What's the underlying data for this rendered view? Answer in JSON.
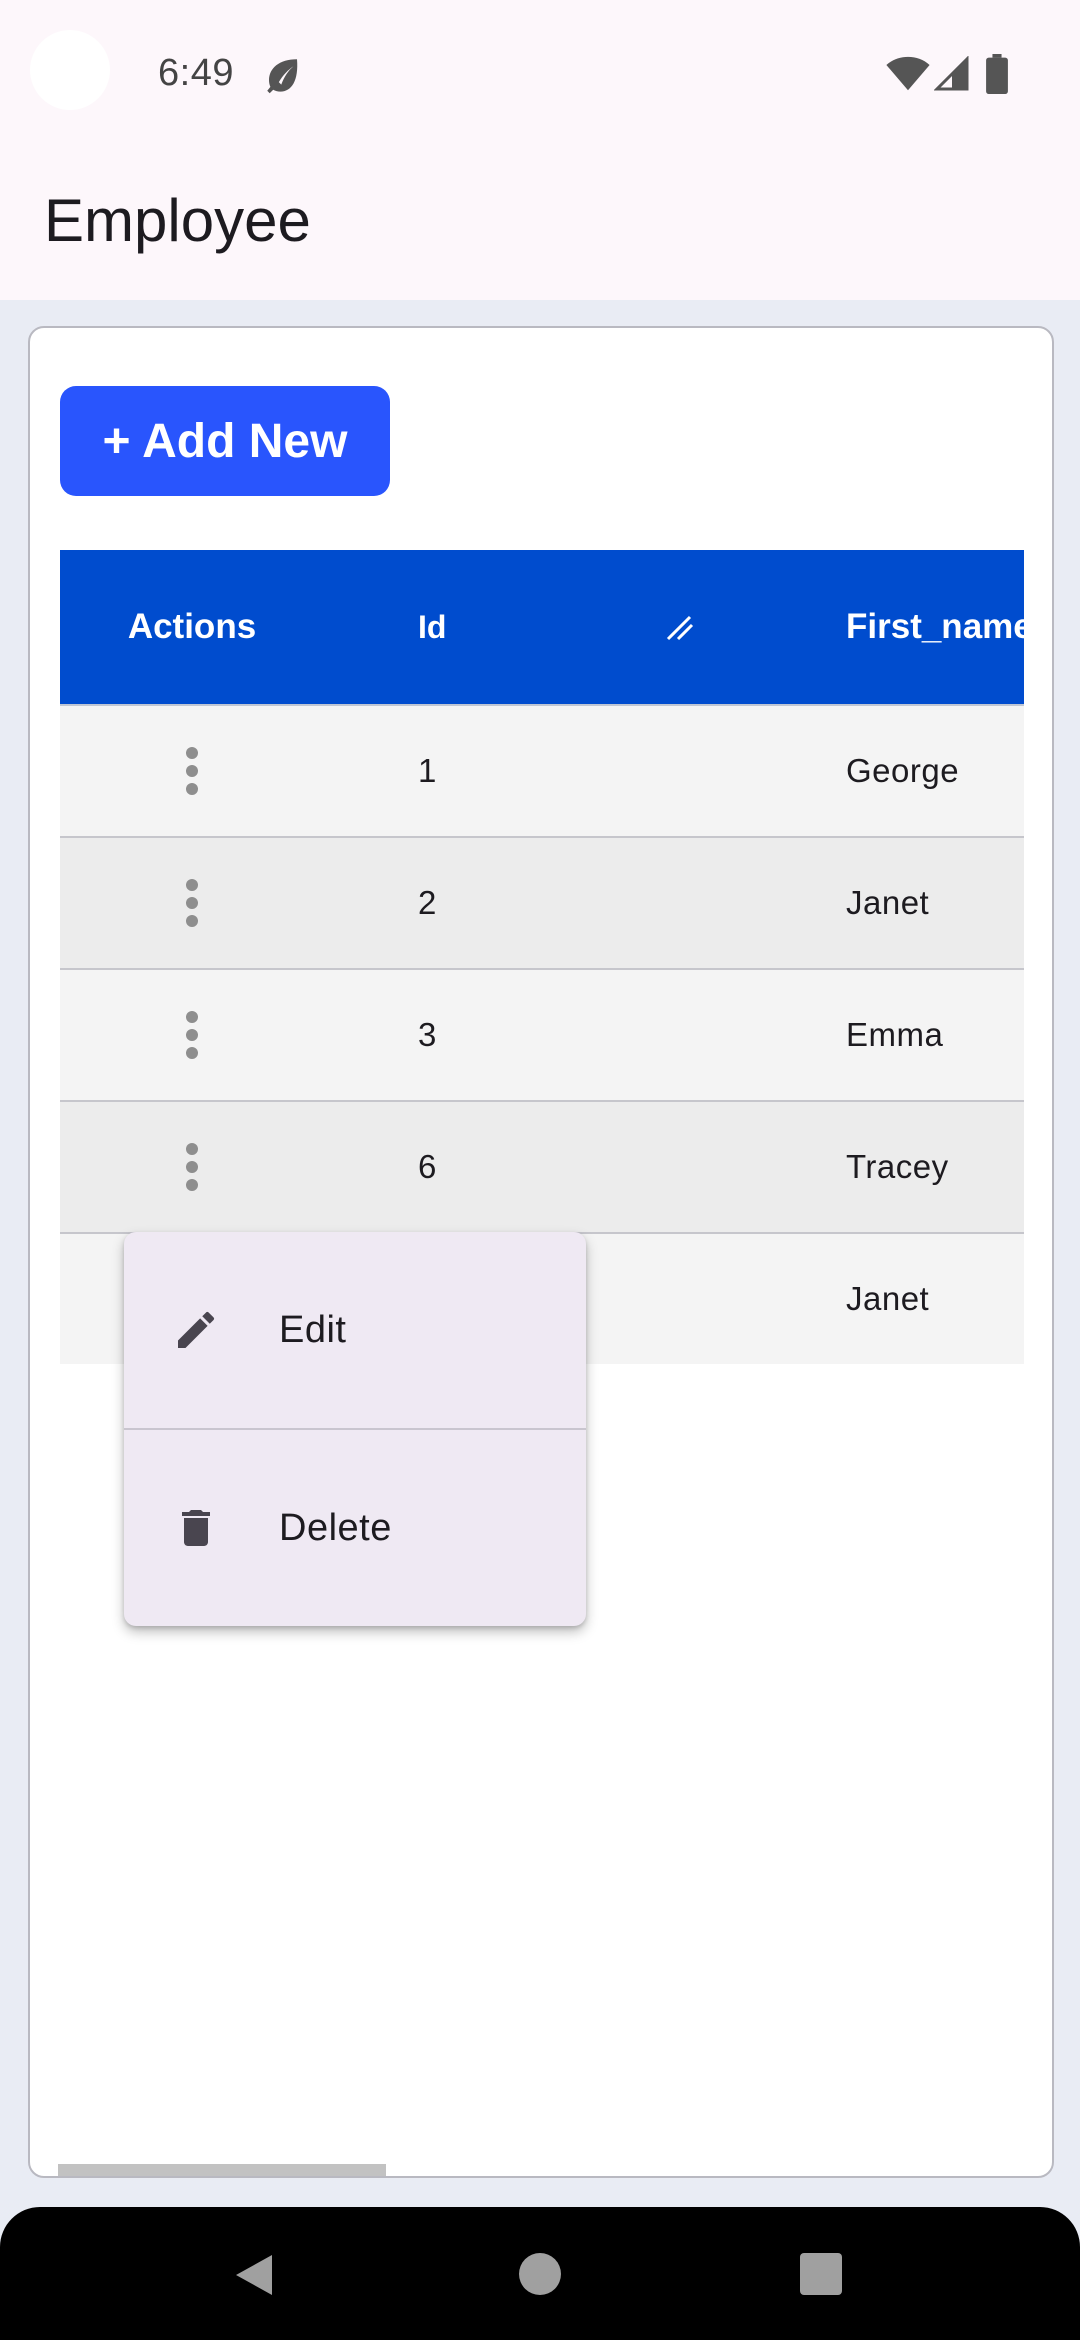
{
  "status_bar": {
    "time": "6:49",
    "icons": [
      "leaf-icon",
      "wifi-icon",
      "cell-signal-icon",
      "battery-icon"
    ]
  },
  "app_bar": {
    "title": "Employee"
  },
  "toolbar": {
    "add_label": "+ Add New"
  },
  "table": {
    "columns": [
      "Actions",
      "Id",
      "First_name"
    ],
    "rows": [
      {
        "id": "1",
        "first_name": "George"
      },
      {
        "id": "2",
        "first_name": "Janet"
      },
      {
        "id": "3",
        "first_name": "Emma"
      },
      {
        "id": "6",
        "first_name": "Tracey"
      },
      {
        "id": "",
        "first_name": "Janet"
      }
    ]
  },
  "context_menu": {
    "items": [
      {
        "label": "Edit",
        "icon": "pencil-icon"
      },
      {
        "label": "Delete",
        "icon": "trash-icon"
      }
    ]
  },
  "colors": {
    "primary_button": "#2955fd",
    "table_header": "#004cce"
  }
}
